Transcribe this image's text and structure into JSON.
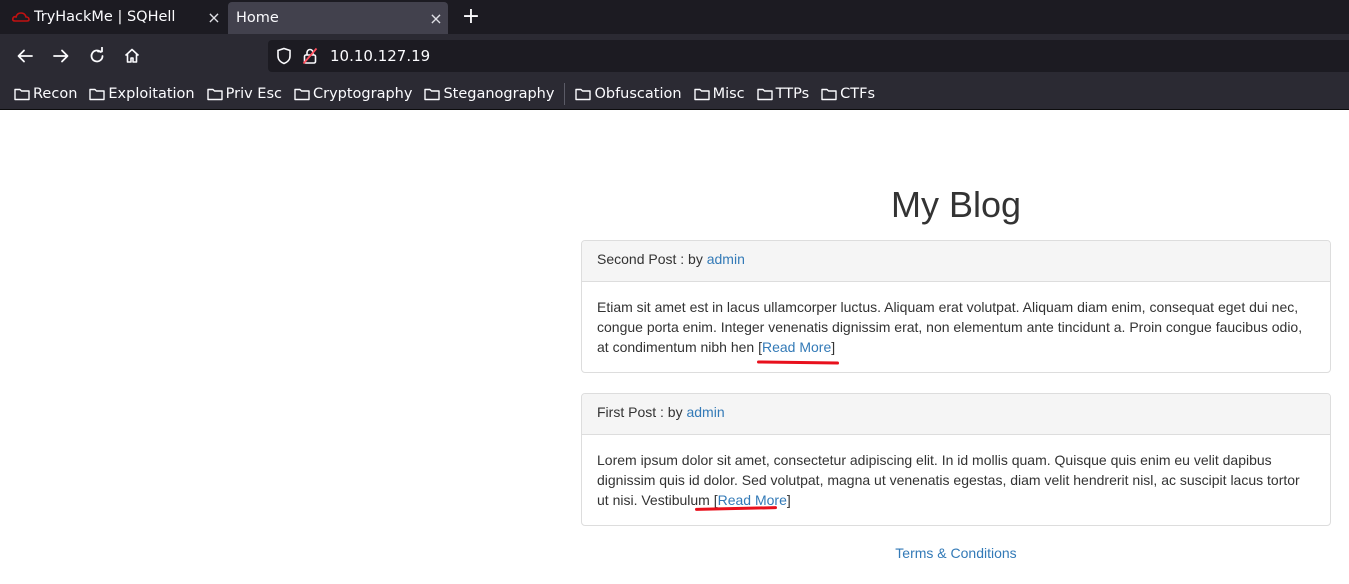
{
  "browser": {
    "tabs": [
      {
        "title": "TryHackMe | SQHell",
        "active": false
      },
      {
        "title": "Home",
        "active": true
      }
    ],
    "tab_close_glyph": "×",
    "new_tab_glyph": "+",
    "url": "10.10.127.19",
    "bookmarks": [
      "Recon",
      "Exploitation",
      "Priv Esc",
      "Cryptography",
      "Steganography",
      "Obfuscation",
      "Misc",
      "TTPs",
      "CTFs"
    ]
  },
  "page": {
    "title": "My Blog",
    "posts": [
      {
        "heading": "Second Post : by ",
        "author": "admin",
        "body": "Etiam sit amet est in lacus ullamcorper luctus. Aliquam erat volutpat. Aliquam diam enim, consequat eget dui nec, congue porta enim. Integer venenatis dignissim erat, non elementum ante tincidunt a. Proin congue faucibus odio, at condimentum nibh hen ",
        "read_more": "Read More"
      },
      {
        "heading": "First Post : by ",
        "author": "admin",
        "body": "Lorem ipsum dolor sit amet, consectetur adipiscing elit. In id mollis quam. Quisque quis enim eu velit dapibus dignissim quis id dolor. Sed volutpat, magna ut venenatis egestas, diam velit hendrerit nisl, ac suscipit lacus tortor ut nisi. Vestibulum ",
        "read_more": "Read More"
      }
    ],
    "footer_link": "Terms & Conditions",
    "bracket_open": "[",
    "bracket_close": "]"
  },
  "colors": {
    "link": "#337ab7",
    "annotation_underline": "#e8101c",
    "tabbar_bg": "#1c1b22",
    "toolbar_bg": "#2b2a33"
  }
}
